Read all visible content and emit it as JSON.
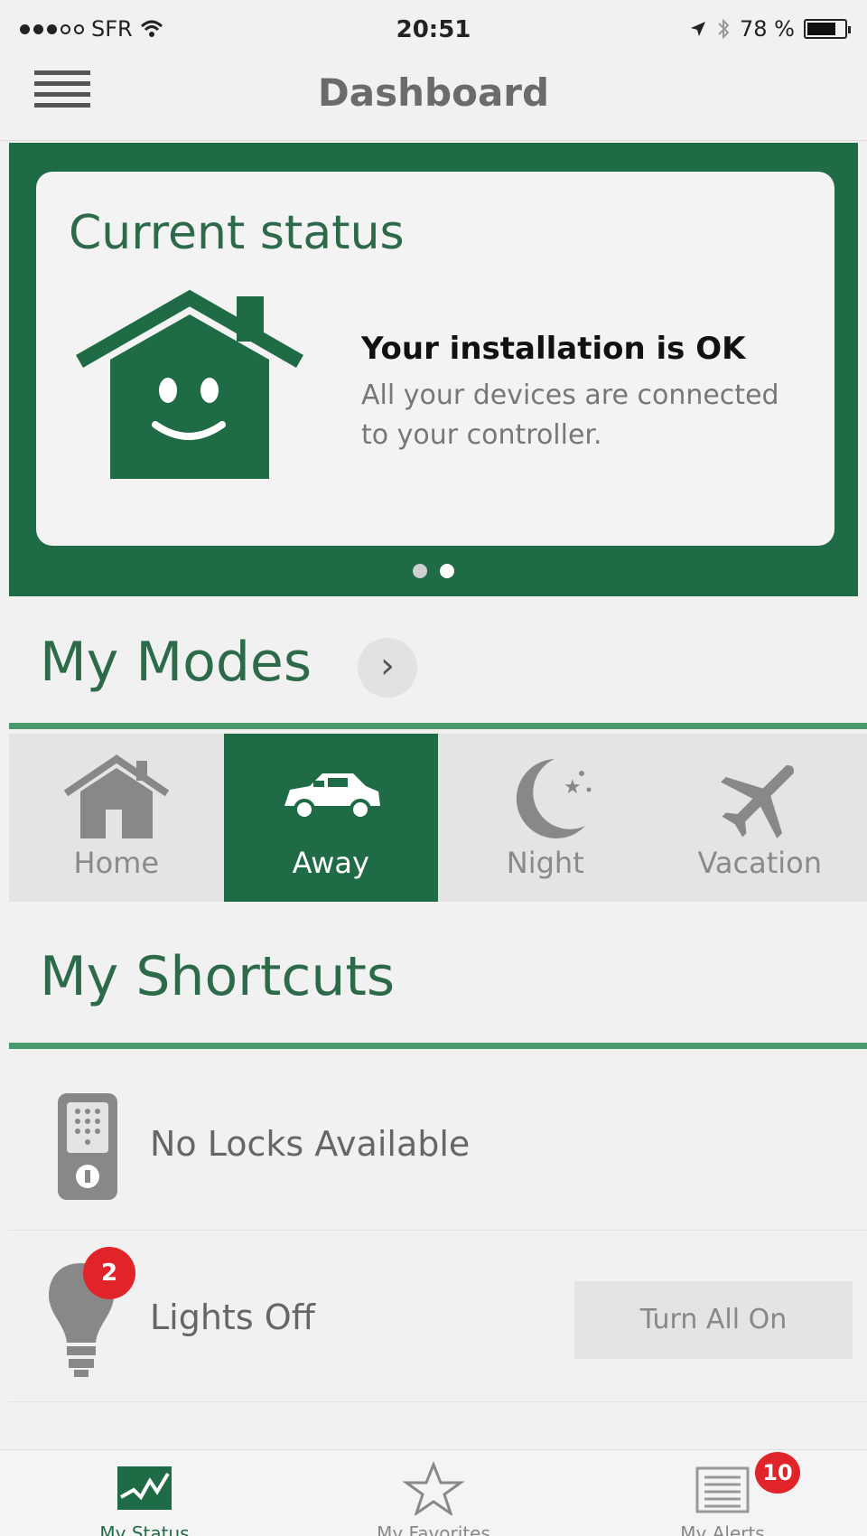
{
  "statusbar": {
    "carrier": "SFR",
    "time": "20:51",
    "battery": "78 %",
    "battery_level": 0.78
  },
  "header": {
    "title": "Dashboard"
  },
  "status_card": {
    "heading": "Current status",
    "main_text": "Your installation is OK",
    "sub_text": "All your devices are connected to your controller.",
    "pager_count": 2,
    "pager_active_index": 1
  },
  "modes": {
    "title": "My Modes",
    "chevron": "›",
    "items": [
      {
        "label": "Home",
        "icon": "house-icon",
        "active": false
      },
      {
        "label": "Away",
        "icon": "car-icon",
        "active": true
      },
      {
        "label": "Night",
        "icon": "moon-icon",
        "active": false
      },
      {
        "label": "Vacation",
        "icon": "airplane-icon",
        "active": false
      }
    ]
  },
  "shortcuts": {
    "title": "My Shortcuts",
    "locks_label": "No Locks Available",
    "lights_label": "Lights Off",
    "lights_badge": "2",
    "lights_button": "Turn All On"
  },
  "tabbar": {
    "items": [
      {
        "label": "My Status",
        "icon": "chart-icon",
        "active": true
      },
      {
        "label": "My Favorites",
        "icon": "star-icon",
        "active": false
      },
      {
        "label": "My Alerts",
        "icon": "list-icon",
        "active": false
      }
    ],
    "alerts_badge": "10"
  },
  "colors": {
    "brand_green": "#1e6b45",
    "accent_line": "#4a9a6e",
    "badge_red": "#e0242a",
    "background": "#f1f1f1"
  }
}
